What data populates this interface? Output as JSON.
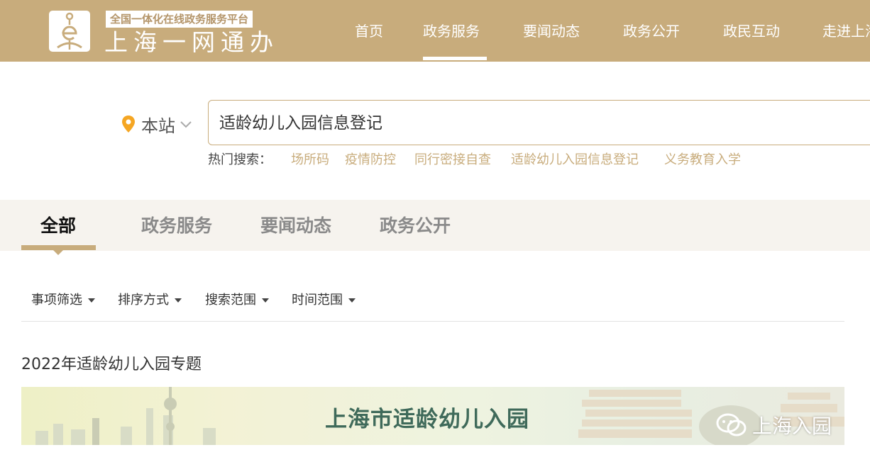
{
  "header": {
    "tagline": "全国一体化在线政务服务平台",
    "brand": "上海一网通办",
    "nav": [
      "首页",
      "政务服务",
      "要闻动态",
      "政务公开",
      "政民互动",
      "走进上海"
    ],
    "active_nav": "政务服务"
  },
  "search": {
    "location_label": "本站",
    "query": "适龄幼儿入园信息登记",
    "hot_label": "热门搜索：",
    "hot_items": [
      "场所码",
      "疫情防控",
      "同行密接自查",
      "适龄幼儿入园信息登记",
      "义务教育入学"
    ]
  },
  "tabs": [
    "全部",
    "政务服务",
    "要闻动态",
    "政务公开"
  ],
  "active_tab": "全部",
  "filters": [
    "事项筛选",
    "排序方式",
    "搜索范围",
    "时间范围"
  ],
  "topic": {
    "title": "2022年适龄幼儿入园专题",
    "banner_title": "上海市适龄幼儿入园",
    "watermark": "上海入园"
  },
  "colors": {
    "brand_gold": "#c8ac7c",
    "tab_band": "#f6f3ee",
    "banner_text": "#3f6a5a"
  },
  "icons": [
    "location-pin-icon",
    "chevron-down-icon",
    "caret-down-icon",
    "wechat-icon"
  ]
}
